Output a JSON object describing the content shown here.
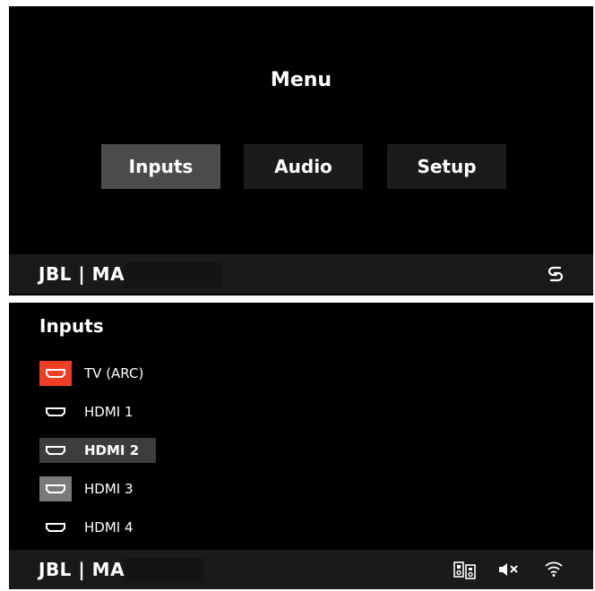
{
  "menu_screen": {
    "title": "Menu",
    "buttons": [
      {
        "label": "Inputs",
        "selected": true
      },
      {
        "label": "Audio",
        "selected": false
      },
      {
        "label": "Setup",
        "selected": false
      }
    ],
    "footer": {
      "brand": "JBL | MA",
      "status_icons": [
        "link-icon"
      ]
    }
  },
  "inputs_screen": {
    "title": "Inputs",
    "items": [
      {
        "label": "TV (ARC)",
        "icon": "hdmi-icon",
        "state": "active-source"
      },
      {
        "label": "HDMI 1",
        "icon": "hdmi-icon",
        "state": "normal"
      },
      {
        "label": "HDMI 2",
        "icon": "hdmi-icon",
        "state": "selected"
      },
      {
        "label": "HDMI 3",
        "icon": "hdmi-icon",
        "state": "highlighted"
      },
      {
        "label": "HDMI 4",
        "icon": "hdmi-icon",
        "state": "normal"
      }
    ],
    "footer": {
      "brand": "JBL | MA",
      "status_icons": [
        "speakers-icon",
        "mute-icon",
        "wifi-icon"
      ]
    }
  },
  "colors": {
    "background": "#000000",
    "footer": "#1a1a1a",
    "button": "#1b1b1b",
    "button_selected": "#4c4c4c",
    "arc_accent": "#ef3e23",
    "row_selected": "#3d3d3d",
    "icon_highlight": "#7a7a7a"
  }
}
